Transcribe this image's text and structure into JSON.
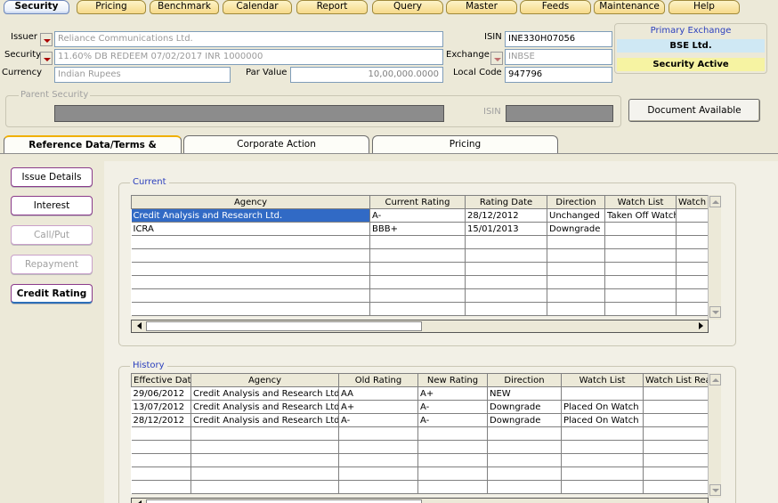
{
  "menu": {
    "items": [
      "Security",
      "Pricing",
      "Benchmark",
      "Calendar",
      "Report",
      "Query",
      "Master",
      "Feeds",
      "Maintenance",
      "Help"
    ],
    "active": "Security"
  },
  "form": {
    "issuer_label": "Issuer",
    "issuer_value": "Reliance Communications Ltd.",
    "security_label": "Security",
    "security_value": "11.60% DB REDEEM 07/02/2017 INR 1000000",
    "currency_label": "Currency",
    "currency_value": "Indian Rupees",
    "par_value_label": "Par Value",
    "par_value_value": "10,00,000.0000",
    "isin_label": "ISIN",
    "isin_value": "INE330H07056",
    "exchange_label": "Exchange",
    "exchange_value": "INBSE",
    "local_code_label": "Local Code",
    "local_code_value": "947796"
  },
  "exchange_box": {
    "title": "Primary Exchange",
    "value": "BSE Ltd.",
    "status": "Security Active"
  },
  "parent_security": {
    "legend": "Parent Security",
    "isin_label": "ISIN",
    "document_button": "Document Available"
  },
  "tabs": [
    "Reference Data/Terms & Conditions",
    "Corporate Action",
    "Pricing"
  ],
  "side_buttons": [
    {
      "label": "Issue Details"
    },
    {
      "label": "Interest"
    },
    {
      "label": "Call/Put"
    },
    {
      "label": "Repayment"
    },
    {
      "label": "Credit Rating"
    }
  ],
  "current": {
    "legend": "Current",
    "columns": [
      "Agency",
      "Current Rating",
      "Rating Date",
      "Direction",
      "Watch List",
      "Watch L"
    ],
    "rows": [
      [
        "Credit Analysis and Research Ltd.",
        "A-",
        "28/12/2012",
        "Unchanged",
        "Taken Off Watch",
        ""
      ],
      [
        "ICRA",
        "BBB+",
        "15/01/2013",
        "Downgrade",
        "",
        ""
      ]
    ]
  },
  "history": {
    "legend": "History",
    "columns": [
      "Effective Date",
      "Agency",
      "Old Rating",
      "New Rating",
      "Direction",
      "Watch List",
      "Watch List Rea"
    ],
    "rows": [
      [
        "29/06/2012",
        "Credit Analysis and Research Ltd.",
        "AA",
        "A+",
        "NEW",
        "",
        ""
      ],
      [
        "13/07/2012",
        "Credit Analysis and Research Ltd.",
        "A+",
        "A-",
        "Downgrade",
        "Placed On Watch",
        ""
      ],
      [
        "28/12/2012",
        "Credit Analysis and Research Ltd.",
        "A-",
        "A-",
        "Downgrade",
        "Placed On Watch",
        ""
      ]
    ]
  }
}
